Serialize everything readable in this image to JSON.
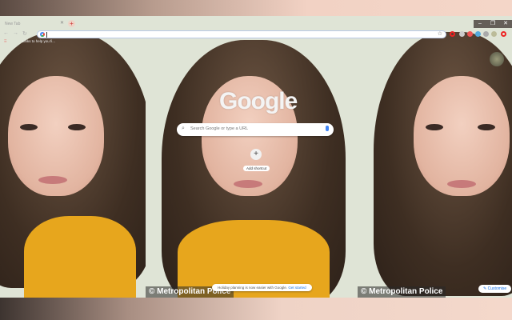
{
  "browser": {
    "tab_title": "New Tab",
    "new_tab": "+",
    "window_controls": [
      "–",
      "❐",
      "✕"
    ],
    "bookmark": "Links to help you fi..."
  },
  "omnibox": {
    "value": "",
    "star_icon": "☆"
  },
  "ntp": {
    "logo": "Google",
    "search_placeholder": "Search Google or type a URL",
    "add_shortcut_icon": "+",
    "add_shortcut": "Add shortcut",
    "promo_text": "Holiday planning is now easier with Google.",
    "promo_link": "Get started",
    "customise": "Customise"
  },
  "wallpaper": {
    "credit": "© Metropolitan Police"
  },
  "colors": {
    "accent": "#1a73e8",
    "shirt": "#e7a61d"
  }
}
